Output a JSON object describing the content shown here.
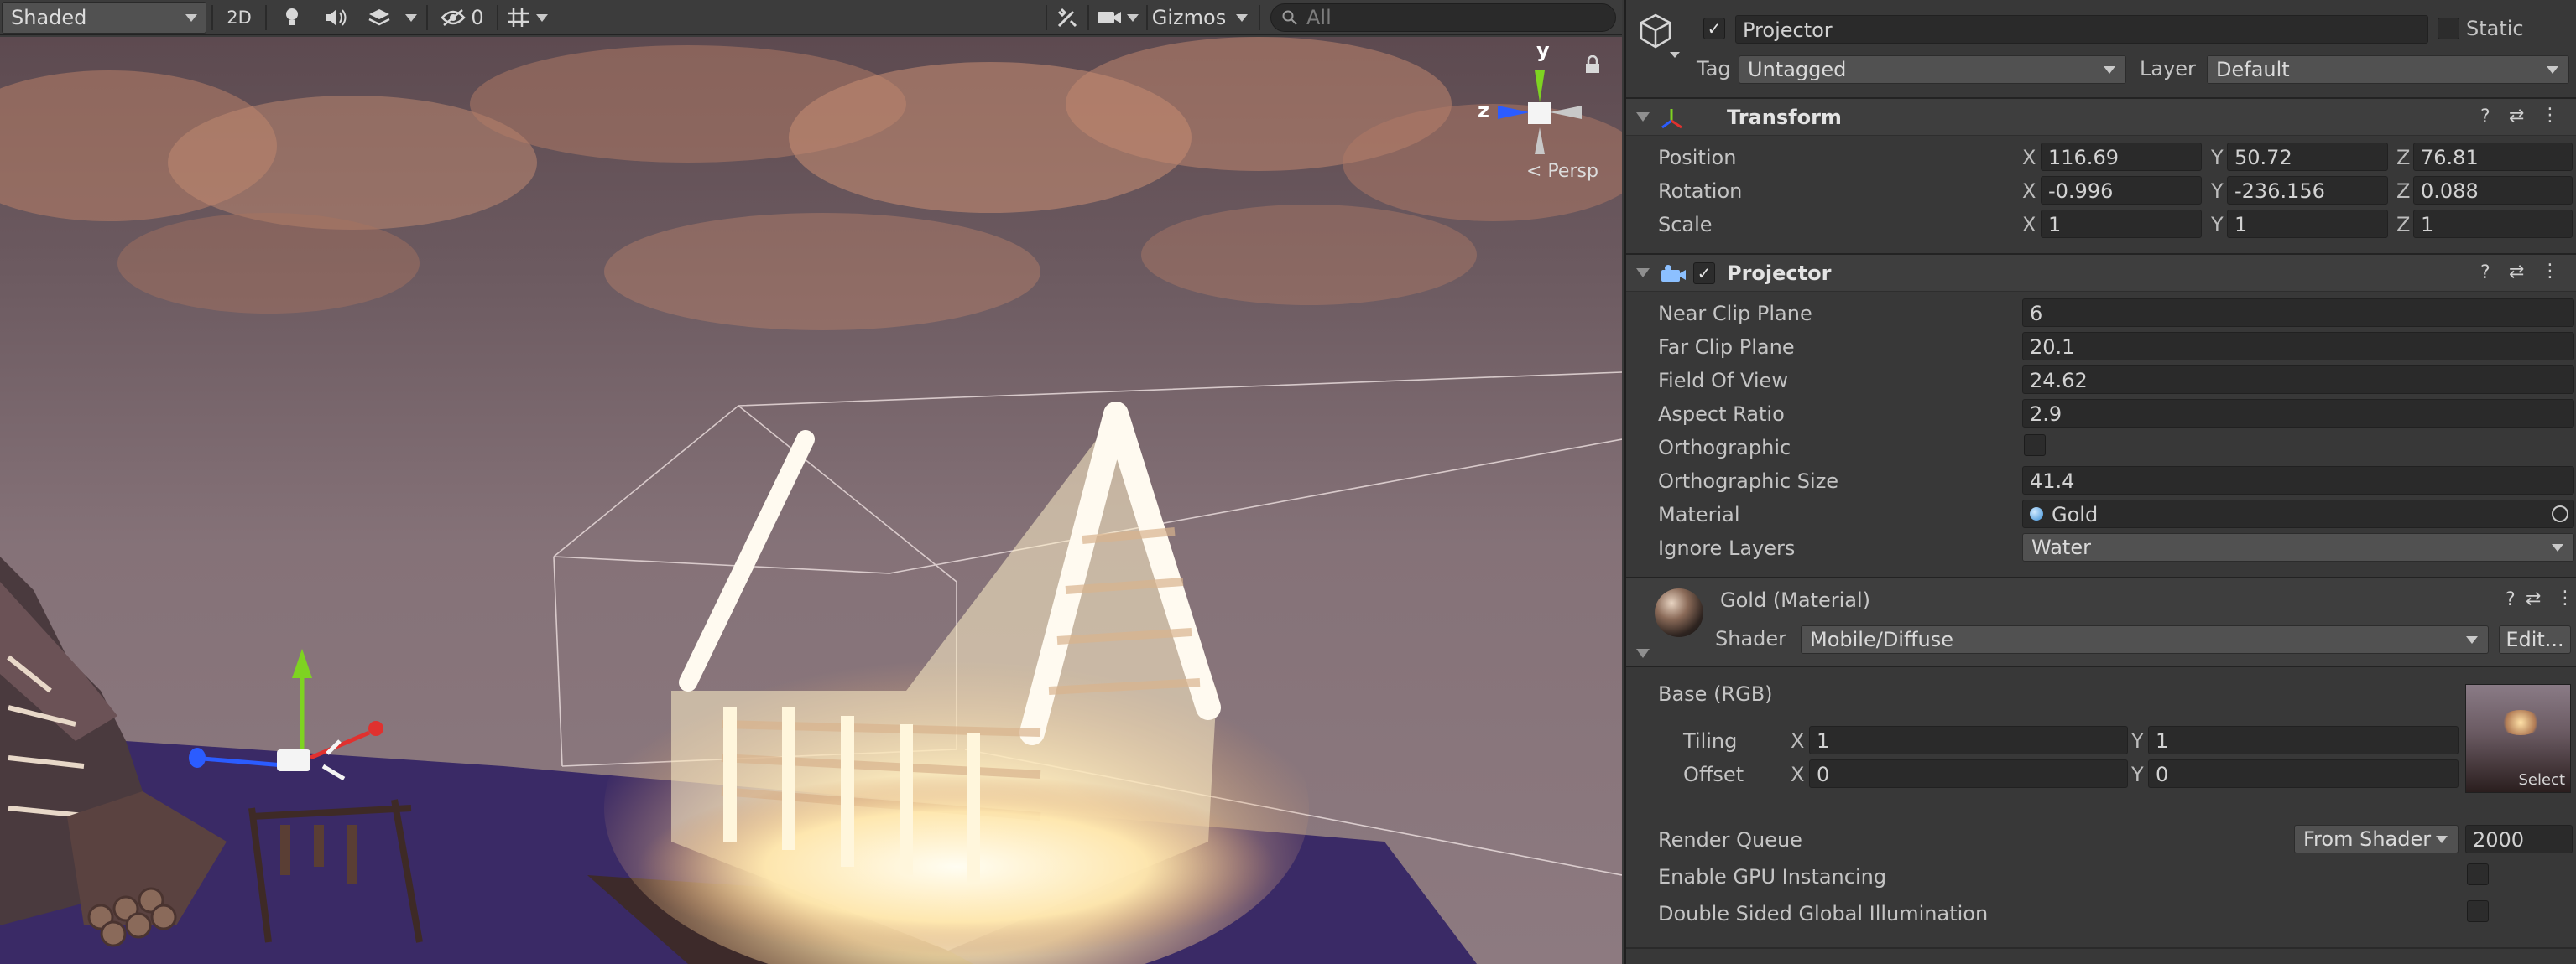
{
  "scene_toolbar": {
    "draw_mode": "Shaded",
    "toggle_2d": "2D",
    "hidden_count": "0",
    "gizmos_label": "Gizmos",
    "search_placeholder": "All"
  },
  "scene_view": {
    "orientation_label": "< Persp",
    "axis_y": "y",
    "axis_z": "z"
  },
  "header": {
    "object_name": "Projector",
    "static_label": "Static",
    "tag_label": "Tag",
    "tag_value": "Untagged",
    "layer_label": "Layer",
    "layer_value": "Default"
  },
  "transform": {
    "title": "Transform",
    "rows": [
      {
        "label": "Position",
        "x": "116.69",
        "y": "50.72",
        "z": "76.81"
      },
      {
        "label": "Rotation",
        "x": "-0.996",
        "y": "-236.156",
        "z": "0.088"
      },
      {
        "label": "Scale",
        "x": "1",
        "y": "1",
        "z": "1"
      }
    ],
    "axis_x": "X",
    "axis_y": "Y",
    "axis_z": "Z"
  },
  "projector": {
    "title": "Projector",
    "near_clip_label": "Near Clip Plane",
    "near_clip": "6",
    "far_clip_label": "Far Clip Plane",
    "far_clip": "20.1",
    "fov_label": "Field Of View",
    "fov": "24.62",
    "aspect_label": "Aspect Ratio",
    "aspect": "2.9",
    "ortho_label": "Orthographic",
    "ortho_size_label": "Orthographic Size",
    "ortho_size": "41.4",
    "material_label": "Material",
    "material": "Gold",
    "ignore_layers_label": "Ignore Layers",
    "ignore_layers": "Water"
  },
  "material": {
    "title": "Gold (Material)",
    "shader_label": "Shader",
    "shader": "Mobile/Diffuse",
    "edit_label": "Edit...",
    "base_label": "Base (RGB)",
    "tiling_label": "Tiling",
    "tiling_x": "1",
    "tiling_y": "1",
    "offset_label": "Offset",
    "offset_x": "0",
    "offset_y": "0",
    "select_label": "Select",
    "render_queue_label": "Render Queue",
    "render_queue_mode": "From Shader",
    "render_queue_value": "2000",
    "gpu_instancing_label": "Enable GPU Instancing",
    "double_sided_label": "Double Sided Global Illumination"
  },
  "colors": {
    "accent_check": "#e6e6e6",
    "gizmo_x": "#e0312f",
    "gizmo_y": "#7ed321",
    "gizmo_z": "#2b5cff",
    "glow": "#fff3c4"
  }
}
